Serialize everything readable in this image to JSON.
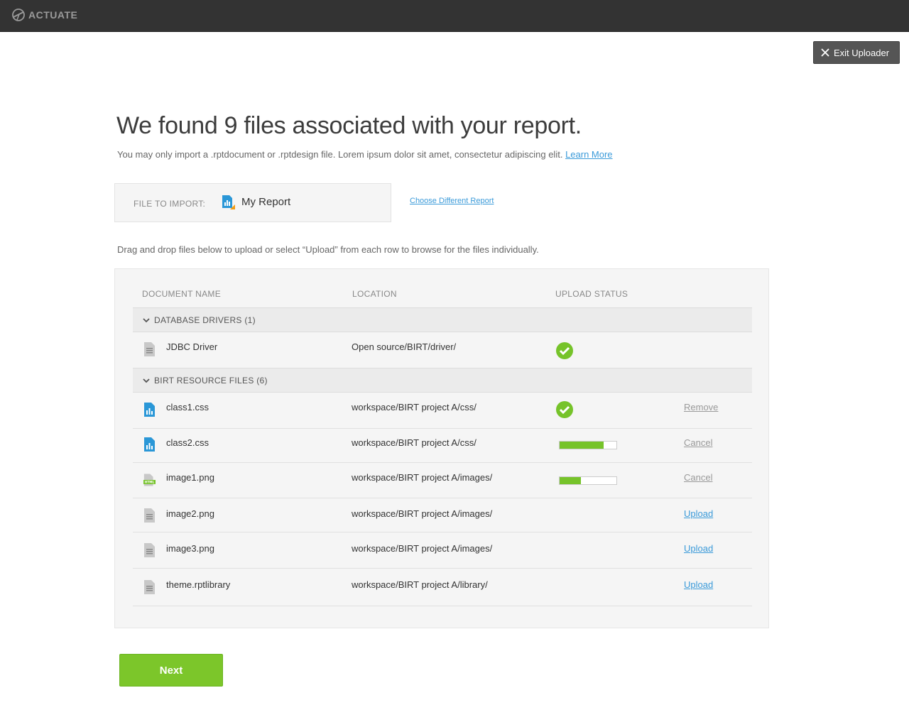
{
  "app": {
    "brand": "ACTUATE"
  },
  "header": {
    "exit_label": "Exit Uploader"
  },
  "main": {
    "headline": "We found 9 files associated with your report.",
    "subline": "You may only import a .rptdocument or .rptdesign file. Lorem ipsum dolor sit amet, consectetur adipiscing elit.",
    "learn_more": "Learn More",
    "import_label": "FILE TO IMPORT:",
    "import_name": "My Report",
    "choose_link": "Choose Different Report",
    "instructions": "Drag and drop files below to upload or select “Upload” from each row to browse for the files individually."
  },
  "table": {
    "columns": [
      "DOCUMENT NAME",
      "LOCATION",
      "UPLOAD STATUS"
    ],
    "groups": [
      {
        "label": "DATABASE DRIVERS (1)"
      },
      {
        "label": "BIRT RESOURCE FILES (6)"
      }
    ],
    "rows": [
      {
        "icon": "document-icon",
        "name": "JDBC Driver",
        "location": "Open source/BIRT/driver/",
        "status": "complete",
        "action": ""
      },
      {
        "icon": "report-icon",
        "name": "class1.css",
        "location": "workspace/BIRT project A/css/",
        "status": "complete",
        "action": "Remove"
      },
      {
        "icon": "report-icon",
        "name": "class2.css",
        "location": "workspace/BIRT project A/css/",
        "status": "uploading",
        "progress": 0.78,
        "action": "Cancel"
      },
      {
        "icon": "html-file-icon",
        "name": "image1.png",
        "location": "workspace/BIRT project A/images/",
        "status": "uploading",
        "progress": 0.38,
        "action": "Cancel"
      },
      {
        "icon": "document-icon",
        "name": "image2.png",
        "location": "workspace/BIRT project A/images/",
        "status": "pending",
        "action": "Upload"
      },
      {
        "icon": "document-icon",
        "name": "image3.png",
        "location": "workspace/BIRT project A/images/",
        "status": "pending",
        "action": "Upload"
      },
      {
        "icon": "document-icon",
        "name": "theme.rptlibrary",
        "location": "workspace/BIRT project A/library/",
        "status": "pending",
        "action": "Upload"
      }
    ]
  },
  "footer": {
    "next_label": "Next"
  },
  "colors": {
    "accent_green": "#7cc62a",
    "link_blue": "#3a9ad9",
    "topbar": "#333333"
  }
}
